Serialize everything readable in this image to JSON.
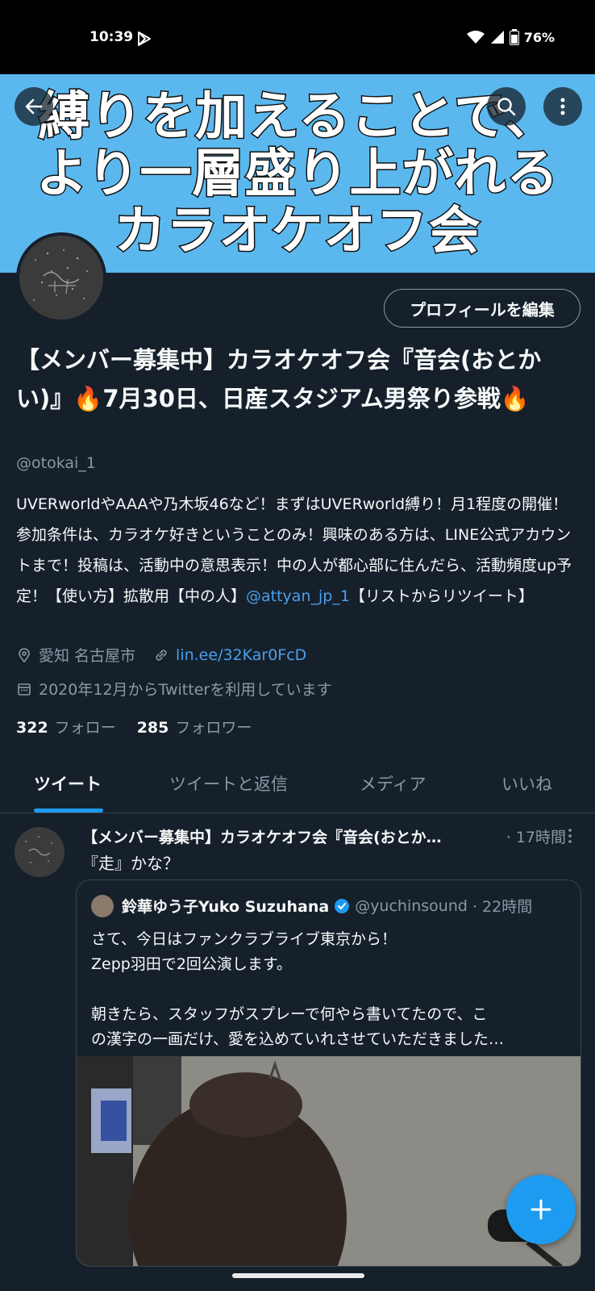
{
  "status_bar": {
    "time": "10:39",
    "battery": "76%"
  },
  "banner": {
    "lines": [
      "縛りを加えることで、",
      "より一層盛り上がれる",
      "カラオケオフ会"
    ]
  },
  "profile": {
    "edit_button": "プロフィールを編集",
    "name": "【メンバー募集中】カラオケオフ会『音会(おとかい)』🔥7月30日、日産スタジアム男祭り参戦🔥",
    "handle": "@otokai_1",
    "bio_text": "UVERworldやAAAや乃木坂46など！まずはUVERworld縛り！月1程度の開催！参加条件は、カラオケ好きということのみ！興味のある方は、LINE公式アカウントまで！投稿は、活動中の意思表示！中の人が都心部に住んだら、活動頻度up予定！【使い方】拡散用【中の人】",
    "bio_mention": "@attyan_jp_1",
    "bio_tail": "【リストからリツイート】",
    "location": "愛知 名古屋市",
    "website": "lin.ee/32Kar0FcD",
    "joined": "2020年12月からTwitterを利用しています",
    "following_count": "322",
    "following_label": "フォロー",
    "followers_count": "285",
    "followers_label": "フォロワー"
  },
  "tabs": [
    "ツイート",
    "ツイートと返信",
    "メディア",
    "いいね"
  ],
  "tweet": {
    "author": "【メンバー募集中】カラオケオフ会『音会(おとか…",
    "time": "· 17時間",
    "text": "『走』かな？",
    "quote": {
      "author": "鈴華ゆう子Yuko Suzuhana",
      "handle": "@yuchinsound",
      "time": "· 22時間",
      "lines": [
        "さて、今日はファンクラブライブ東京から！",
        "Zepp羽田で2回公演します。",
        "",
        "朝きたら、スタッフがスプレーで何やら書いてたので、こ",
        "の漢字の一画だけ、愛を込めていれさせていただきました…"
      ]
    }
  },
  "colors": {
    "background": "#15202b",
    "accent": "#1d9bf0",
    "banner": "#5bb8ee"
  }
}
